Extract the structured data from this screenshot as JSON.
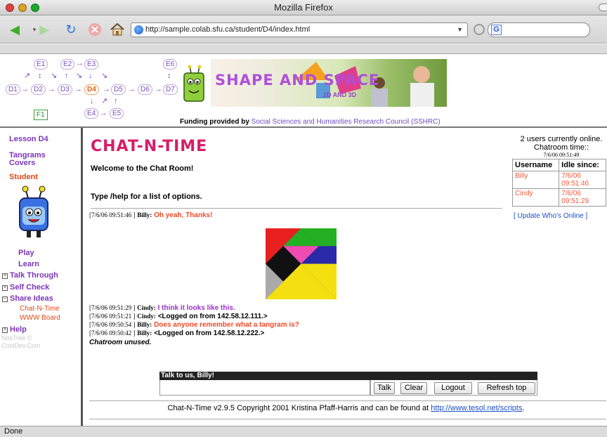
{
  "window": {
    "title": "Mozilla Firefox"
  },
  "browser": {
    "url": "http://sample.colab.sfu.ca/student/D4/index.html",
    "status": "Done"
  },
  "header": {
    "nav_nodes": {
      "e1": "E1",
      "e2": "E2",
      "e3": "E3",
      "e6": "E6",
      "d1": "D1",
      "d2": "D2",
      "d3": "D3",
      "d4": "D4",
      "d5": "D5",
      "d6": "D6",
      "d7": "D7",
      "e4": "E4",
      "e5": "E5",
      "f1": "F1"
    },
    "banner_title": "SHAPE AND SPACE",
    "banner_sub": "2D AND 3D",
    "funding_prefix": "Funding provided by",
    "funding_link": "Social Sciences and Humanities Research Council (SSHRC)"
  },
  "sidebar": {
    "lesson": "Lesson D4",
    "tangrams": "Tangrams",
    "covers": "Covers",
    "student": "Student",
    "play": "Play",
    "learn": "Learn",
    "talk_through": "Talk Through",
    "self_check": "Self Check",
    "share_ideas": "Share Ideas",
    "chat_n_time": "Chat-N-Time",
    "www_board": "WWW Board",
    "help": "Help",
    "credit_line1": "NosTree ©",
    "credit_line2": "CoolDev.Com"
  },
  "chat": {
    "logo": "CHAT-N-TIME",
    "welcome": "Welcome to the Chat Room!",
    "help_tip": "Type /help for a list of options.",
    "messages": [
      {
        "ts": "[7/6/06 09:51:46 ]",
        "user": "Billy:",
        "text": "Oh yeah, Thanks!"
      },
      {
        "ts": "[7/6/06 09:51:29 ]",
        "user": "Cindy:",
        "text": "I think it looks like this."
      },
      {
        "ts": "[7/6/06 09:51:21 ]",
        "user": "Cindy:",
        "text": "<Logged on from 142.58.12.111.>"
      },
      {
        "ts": "[7/6/06 09:50:54 ]",
        "user": "Billy:",
        "text": "Does anyone remember what a tangram is?"
      },
      {
        "ts": "[7/6/06 09:50:42 ]",
        "user": "Billy:",
        "text": "<Logged on from 142.58.12.222.>"
      }
    ],
    "unused": "Chatroom unused.",
    "talk_label": "Talk to us, Billy!",
    "input_value": "",
    "buttons": {
      "talk": "Talk",
      "clear": "Clear",
      "logout": "Logout",
      "refresh": "Refresh top"
    },
    "footer_text": "Chat-N-Time v2.9.5 Copyright 2001 Kristina Pfaff-Harris and can be found at",
    "footer_link": "http://www.tesol.net/scripts",
    "footer_end": "."
  },
  "users": {
    "online_count": "2 users currently online.",
    "time_label": "Chatroom time::",
    "time_value": "7/6/06 09:51:49",
    "col_username": "Username",
    "col_idle": "Idle since:",
    "rows": [
      {
        "name": "Billy",
        "idle_date": "7/6/06",
        "idle_time": "09:51:46"
      },
      {
        "name": "Cindy",
        "idle_date": "7/6/06",
        "idle_time": "09:51:29"
      }
    ],
    "update_link": "[ Update Who's Online ]"
  },
  "colors": {
    "accent_purple": "#7a35b8",
    "accent_orange": "#e04818",
    "logo_pink": "#d81c68",
    "link_blue": "#1a4fc8"
  }
}
